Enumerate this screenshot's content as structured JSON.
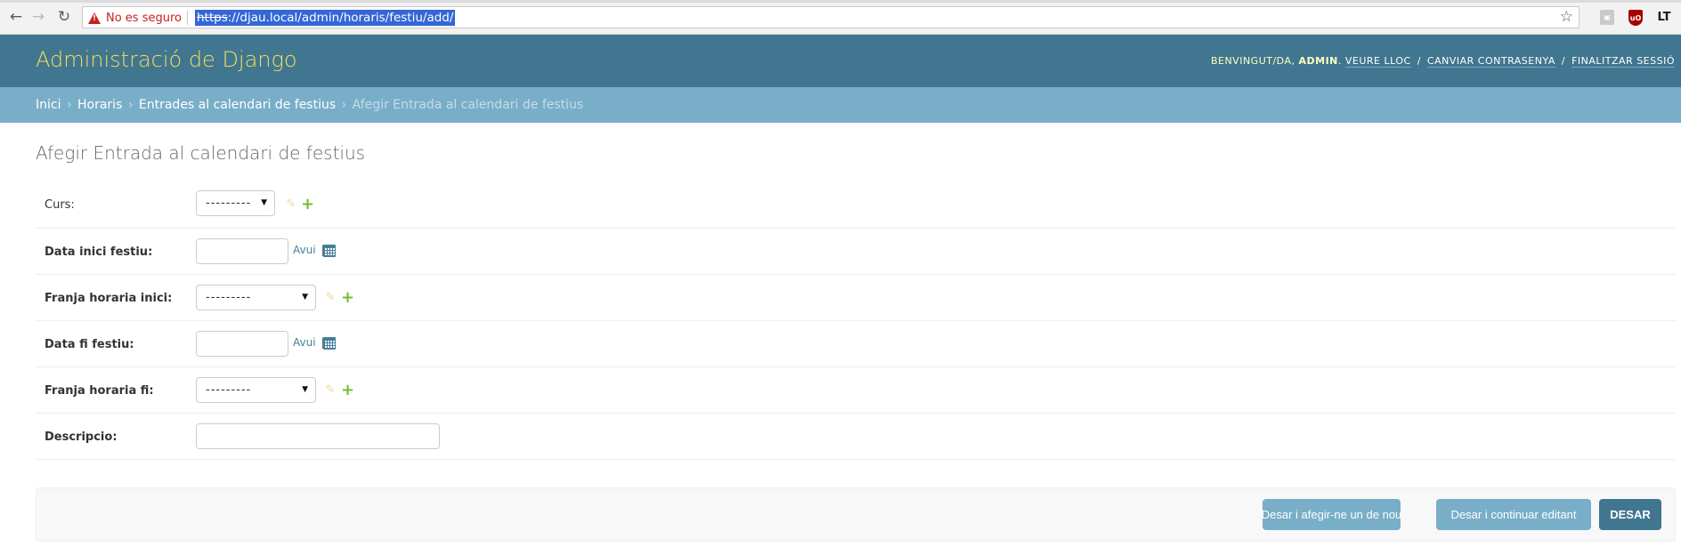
{
  "browser": {
    "back_icon": "←",
    "forward_icon": "→",
    "reload_icon": "↻",
    "security_text": "No es seguro",
    "url_scheme": "https",
    "url_rest": "://djau.local/admin/horaris/festiu/add/",
    "star_icon": "☆",
    "ext_badge_1": "▣",
    "ext_badge_2": "uO",
    "ext_badge_3": "LT"
  },
  "header": {
    "site_name": "Administració de Django",
    "welcome": "Benvingut/da,",
    "username": "admin",
    "view_site": "Veure lloc",
    "change_password": "Canviar contrasenya",
    "logout": "Finalitzar sessió",
    "separator": "/"
  },
  "breadcrumbs": {
    "home": "Inici",
    "app": "Horaris",
    "model": "Entrades al calendari de festius",
    "current": "Afegir Entrada al calendari de festius",
    "arrow": "›"
  },
  "page": {
    "title": "Afegir Entrada al calendari de festius"
  },
  "form": {
    "curs": {
      "label": "Curs:",
      "value": "---------"
    },
    "data_inici": {
      "label": "Data inici festiu:",
      "value": "",
      "today": "Avui",
      "pipe": "|"
    },
    "franja_inici": {
      "label": "Franja horaria inici:",
      "value": "---------"
    },
    "data_fi": {
      "label": "Data fi festiu:",
      "value": "",
      "today": "Avui",
      "pipe": "|"
    },
    "franja_fi": {
      "label": "Franja horaria fi:",
      "value": "---------"
    },
    "descripcio": {
      "label": "Descripcio:",
      "value": ""
    },
    "edit_icon": "✎",
    "add_icon": "+",
    "caret": "▼"
  },
  "actions": {
    "save_add_another": "Desar i afegir-ne un de nou",
    "save_continue": "Desar i continuar editant",
    "save": "DESAR"
  },
  "colors": {
    "header_bg": "#417690",
    "breadcrumbs_bg": "#79aec8",
    "branding": "#f5dd5d",
    "add_green": "#70bf2b",
    "link": "#447e9b"
  }
}
